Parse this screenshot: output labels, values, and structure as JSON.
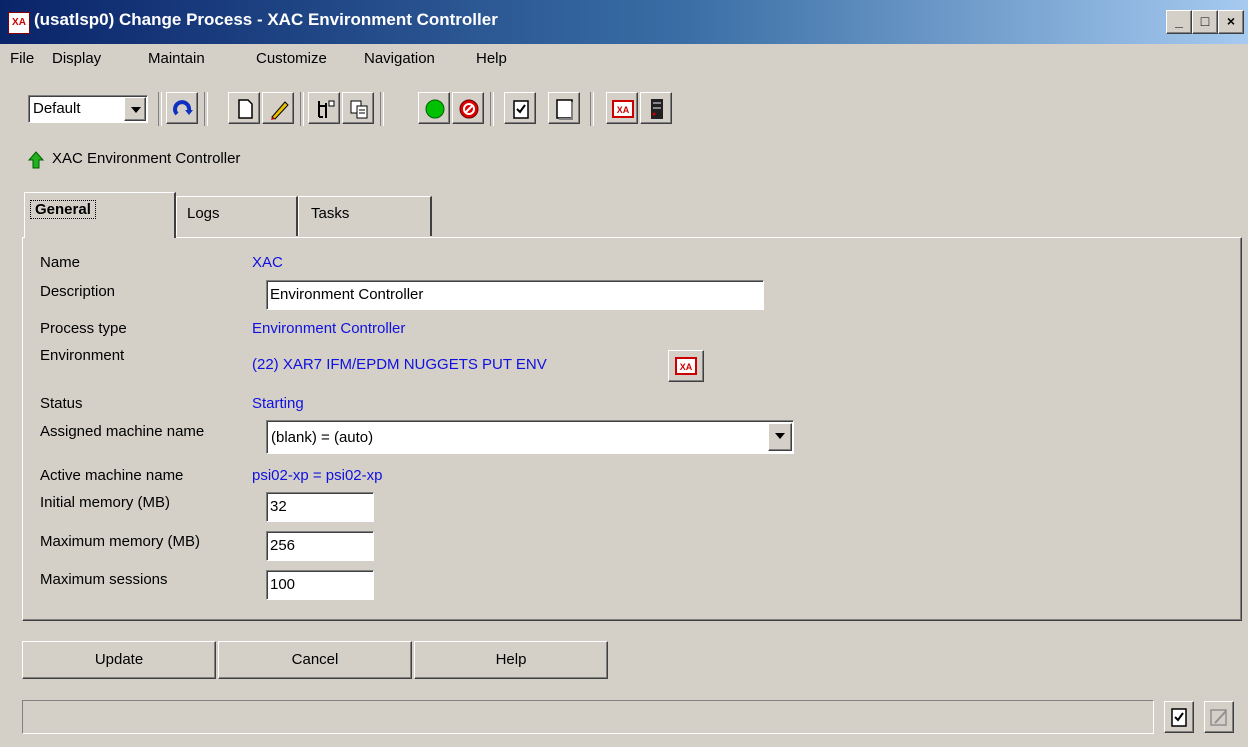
{
  "window": {
    "icon": "XA",
    "title": "(usatlsp0) Change Process - XAC  Environment Controller",
    "controls": {
      "minimize": "_",
      "maximize": "□",
      "close": "×"
    }
  },
  "menu": [
    "File",
    "Display",
    "Maintain",
    "Customize",
    "Navigation",
    "Help"
  ],
  "toolbar": {
    "view_select_value": "Default",
    "buttons": [
      "refresh-icon",
      "new-document-icon",
      "edit-pencil-icon",
      "tree-icon",
      "copy-icon",
      "start-green-icon",
      "stop-red-icon",
      "checklist-icon",
      "blank-page-icon",
      "xa-logo-icon",
      "server-icon"
    ]
  },
  "breadcrumb": {
    "icon": "up-arrow-icon",
    "text": "XAC  Environment Controller"
  },
  "tabs": [
    "General",
    "Logs",
    "Tasks"
  ],
  "form": {
    "name_label": "Name",
    "name_value": "XAC",
    "description_label": "Description",
    "description_value": "Environment Controller",
    "process_type_label": "Process type",
    "process_type_value": "Environment Controller",
    "environment_label": "Environment",
    "environment_value": "(22)  XAR7 IFM/EPDM NUGGETS PUT ENV",
    "status_label": "Status",
    "status_value": "Starting",
    "assigned_machine_label": "Assigned machine name",
    "assigned_machine_value": "(blank) = (auto)",
    "active_machine_label": "Active machine name",
    "active_machine_value": "psi02-xp = psi02-xp",
    "initial_memory_label": "Initial memory (MB)",
    "initial_memory_value": "32",
    "max_memory_label": "Maximum memory (MB)",
    "max_memory_value": "256",
    "max_sessions_label": "Maximum sessions",
    "max_sessions_value": "100"
  },
  "actions": {
    "update": "Update",
    "cancel": "Cancel",
    "help": "Help"
  },
  "colors": {
    "link_value": "#1010e0",
    "title_bar": "#0a246a",
    "chrome": "#d4d0c8"
  }
}
